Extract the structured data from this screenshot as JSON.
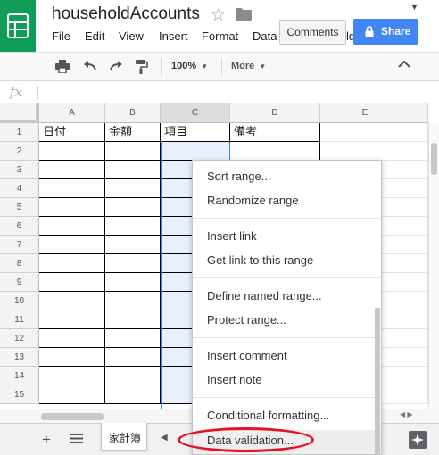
{
  "header": {
    "title": "householdAccounts",
    "menus": [
      "File",
      "Edit",
      "View",
      "Insert",
      "Format",
      "Data"
    ],
    "menu_extra": "ld",
    "comments_label": "Comments",
    "share_label": "Share"
  },
  "toolbar": {
    "zoom": "100%",
    "more": "More"
  },
  "formula_bar": {
    "fx": "fx",
    "value": ""
  },
  "grid": {
    "columns": [
      "A",
      "B",
      "C",
      "D",
      "E"
    ],
    "rows": [
      "1",
      "2",
      "3",
      "4",
      "5",
      "6",
      "7",
      "8",
      "9",
      "10",
      "11",
      "12",
      "13",
      "14",
      "15"
    ],
    "header_row": [
      "日付",
      "金額",
      "項目",
      "備考"
    ]
  },
  "sheets": {
    "active_tab": "家計簿"
  },
  "context_menu": {
    "items": [
      "Sort range...",
      "Randomize range",
      "Insert link",
      "Get link to this range",
      "Define named range...",
      "Protect range...",
      "Insert comment",
      "Insert note",
      "Conditional formatting...",
      "Data validation..."
    ]
  },
  "colors": {
    "brand_green": "#0f9d58",
    "share_blue": "#4285f4",
    "selection": "#e8f0fe",
    "annotation_red": "#e81123"
  }
}
